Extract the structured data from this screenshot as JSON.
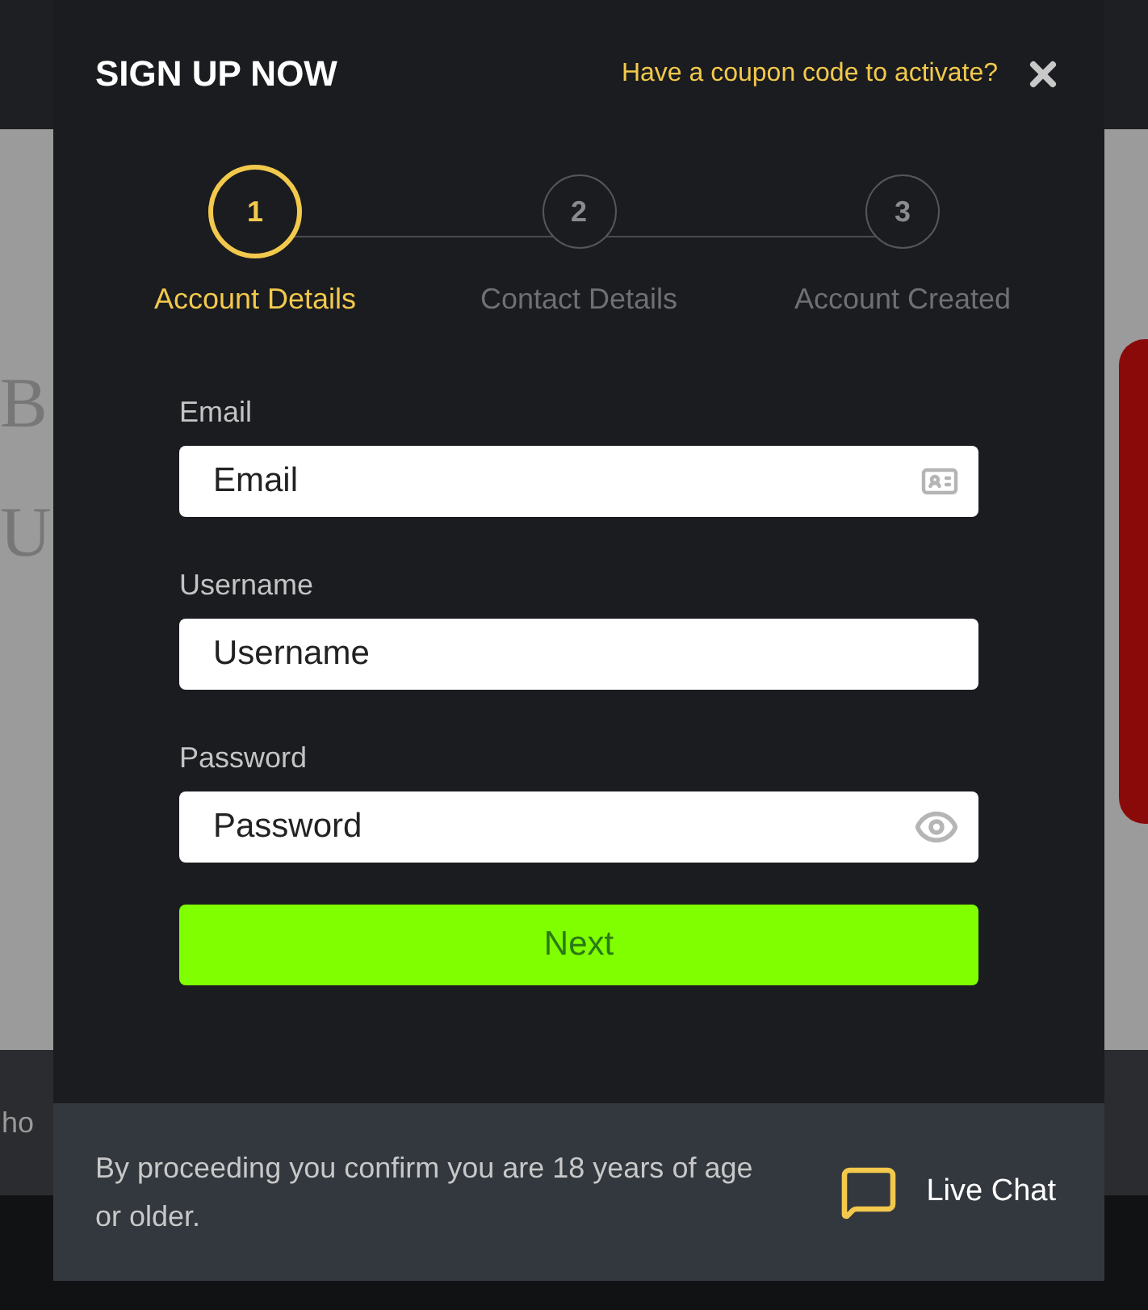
{
  "background_page": {
    "texts": [
      "B",
      "U",
      "ho"
    ]
  },
  "dialog": {
    "title": "SIGN UP NOW",
    "coupon_link": "Have a coupon code to activate?",
    "steps": [
      {
        "number": "1",
        "label": "Account Details",
        "selected": true
      },
      {
        "number": "2",
        "label": "Contact Details",
        "selected": false
      },
      {
        "number": "3",
        "label": "Account Created",
        "selected": false
      }
    ],
    "fields": [
      {
        "kind": "email",
        "label": "Email",
        "placeholder": "Email"
      },
      {
        "kind": "text",
        "label": "Username",
        "placeholder": "Username"
      },
      {
        "kind": "password",
        "label": "Password",
        "placeholder": "Password"
      }
    ],
    "next_button": "Next",
    "footer": {
      "notice": "By proceeding you confirm you are 18 years of age or older.",
      "live_chat": "Live Chat"
    }
  }
}
